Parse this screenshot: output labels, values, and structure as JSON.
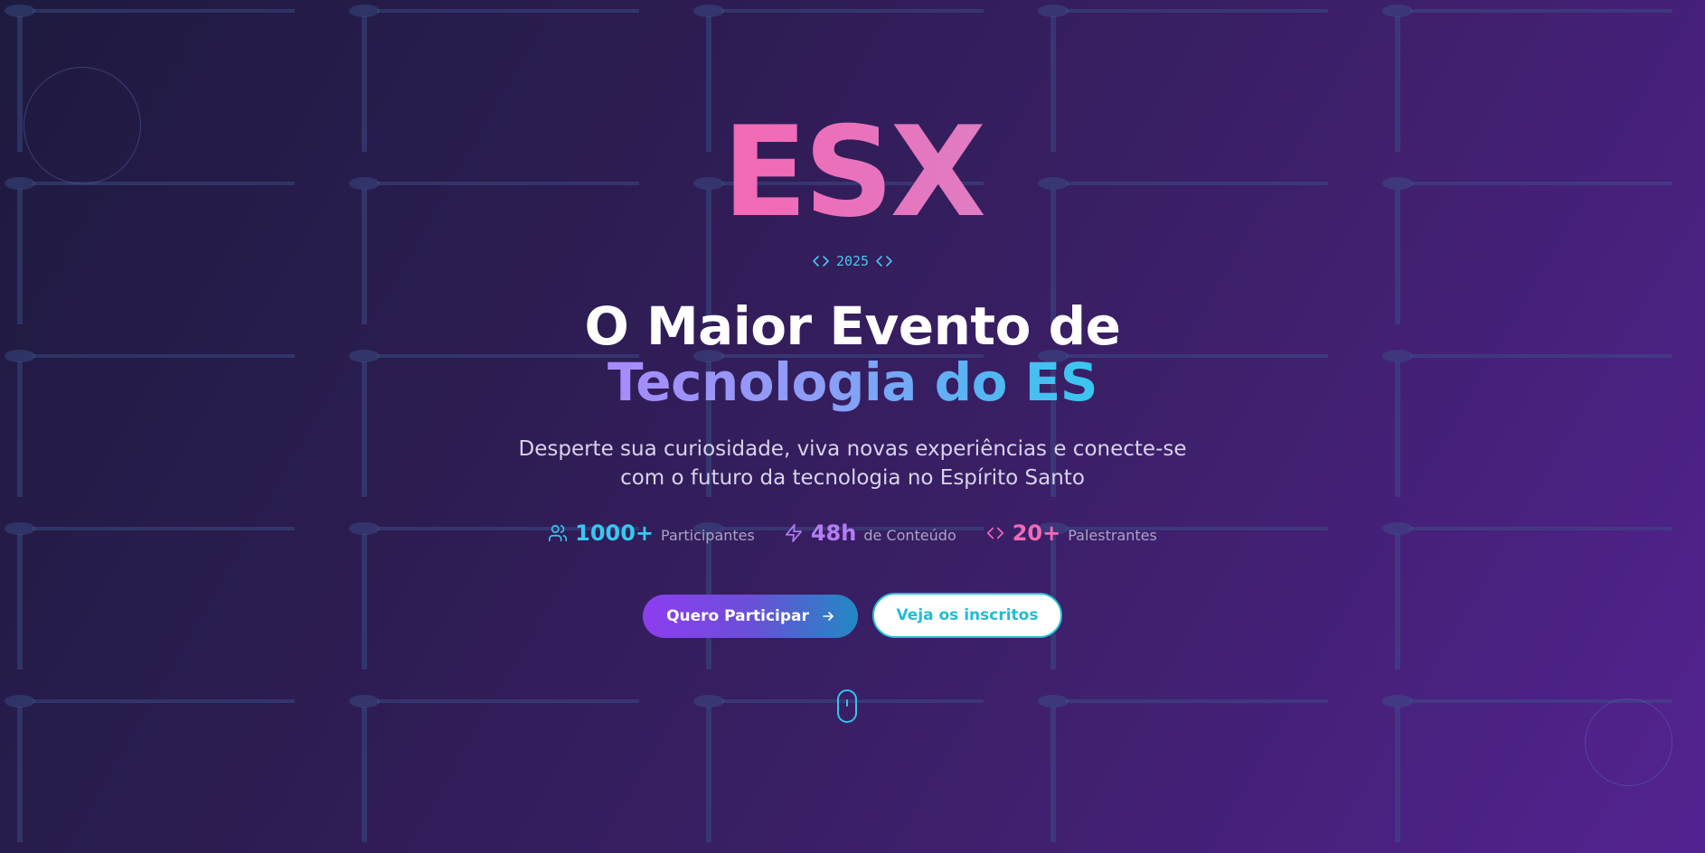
{
  "hero": {
    "logo": "ESX",
    "year": "2025",
    "title_line1": "O Maior Evento de",
    "title_line2": "Tecnologia do ES",
    "subtitle_line1": "Desperte sua curiosidade, viva novas experiências e conecte-se",
    "subtitle_line2": "com o futuro da tecnologia no Espírito Santo"
  },
  "stats": [
    {
      "icon": "users-icon",
      "value": "1000+",
      "label": "Participantes",
      "color": "#38c8ef"
    },
    {
      "icon": "lightning-icon",
      "value": "48h",
      "label": "de Conteúdo",
      "color": "#b57cf5"
    },
    {
      "icon": "code-icon",
      "value": "20+",
      "label": "Palestrantes",
      "color": "#f06ab6"
    }
  ],
  "actions": {
    "primary_label": "Quero Participar",
    "secondary_label": "Veja os inscritos"
  },
  "colors": {
    "accent_cyan": "#38c8ef",
    "accent_purple": "#8d3df0",
    "accent_pink": "#f06ab6",
    "background_start": "#1e1a3f",
    "background_end": "#532291"
  }
}
